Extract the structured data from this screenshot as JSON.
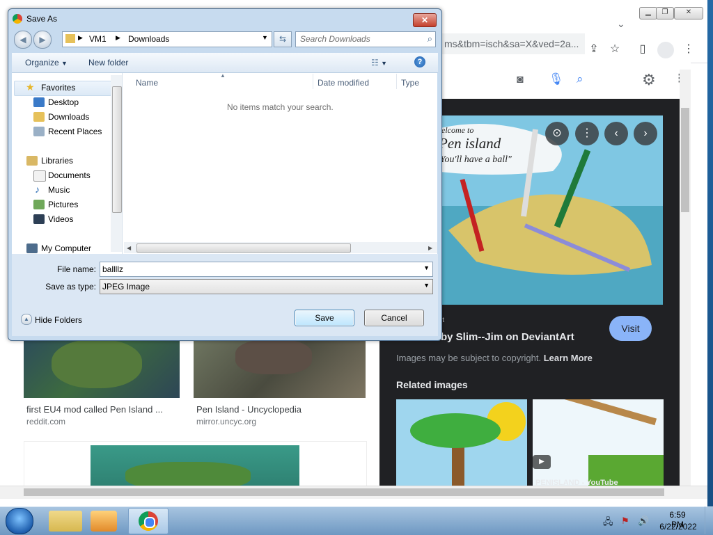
{
  "chrome": {
    "omnibox_text": "ms&tbm=isch&sa=X&ved=2a...",
    "image_title": "by Slim--Jim on DeviantArt",
    "image_source_label": "rt",
    "visit_label": "Visit",
    "copyright_text": "Images may be subject to copyright.",
    "learn_more": "Learn More",
    "related_heading": "Related images",
    "related_caption": "PENISLAND - YouTube",
    "main_image_text_1": "elcome to",
    "main_image_text_2": "Pen island",
    "main_image_text_3": "You'll have a ball\""
  },
  "results": [
    {
      "caption": "first EU4 mod called Pen Island ...",
      "source": "reddit.com"
    },
    {
      "caption": "Pen Island - Uncyclopedia",
      "source": "mirror.uncyc.org"
    }
  ],
  "dialog": {
    "title": "Save As",
    "close_label": "✕",
    "breadcrumb": [
      "VM1",
      "Downloads"
    ],
    "search_placeholder": "Search Downloads",
    "organize_label": "Organize",
    "new_folder_label": "New folder",
    "help_label": "?",
    "nav": {
      "favorites_label": "Favorites",
      "favorites": [
        "Desktop",
        "Downloads",
        "Recent Places"
      ],
      "libraries_label": "Libraries",
      "libraries": [
        "Documents",
        "Music",
        "Pictures",
        "Videos"
      ],
      "computer_label": "My Computer"
    },
    "columns": [
      "Name",
      "Date modified",
      "Type"
    ],
    "empty_message": "No items match your search.",
    "file_name_label": "File name:",
    "file_name_value": "ballllz",
    "save_type_label": "Save as type:",
    "save_type_value": "JPEG Image",
    "hide_folders_label": "Hide Folders",
    "save_label": "Save",
    "cancel_label": "Cancel"
  },
  "taskbar": {
    "time": "6:59 PM",
    "date": "6/22/2022"
  }
}
